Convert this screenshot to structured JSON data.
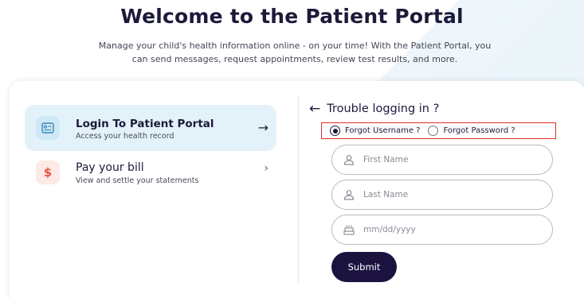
{
  "hero": {
    "title": "Welcome to the Patient Portal",
    "subtitle_line1": "Manage your child's health information online - on your time! With the Patient Portal, you",
    "subtitle_line2": "can send messages, request appointments, review test results, and more."
  },
  "nav": {
    "items": [
      {
        "title": "Login To Patient Portal",
        "desc": "Access your health record",
        "arrow": "→",
        "icon": "id-card-icon",
        "active": true
      },
      {
        "title": "Pay your bill",
        "desc": "View and settle your statements",
        "arrow": "›",
        "icon": "dollar-icon",
        "active": false
      }
    ]
  },
  "recovery": {
    "back_arrow": "←",
    "title": "Trouble logging in ?",
    "options": [
      {
        "label": "Forgot Username ?",
        "selected": true
      },
      {
        "label": "Forgot Password ?",
        "selected": false
      }
    ],
    "fields": {
      "first_name": {
        "placeholder": "First Name",
        "value": ""
      },
      "last_name": {
        "placeholder": "Last Name",
        "value": ""
      },
      "dob": {
        "placeholder": "mm/dd/yyyy",
        "value": ""
      }
    },
    "submit_label": "Submit"
  },
  "colors": {
    "primary": "#1b1240",
    "highlight_border": "#d9302c",
    "active_nav_bg": "#e3f1f8",
    "bill_icon": "#e8544a"
  }
}
